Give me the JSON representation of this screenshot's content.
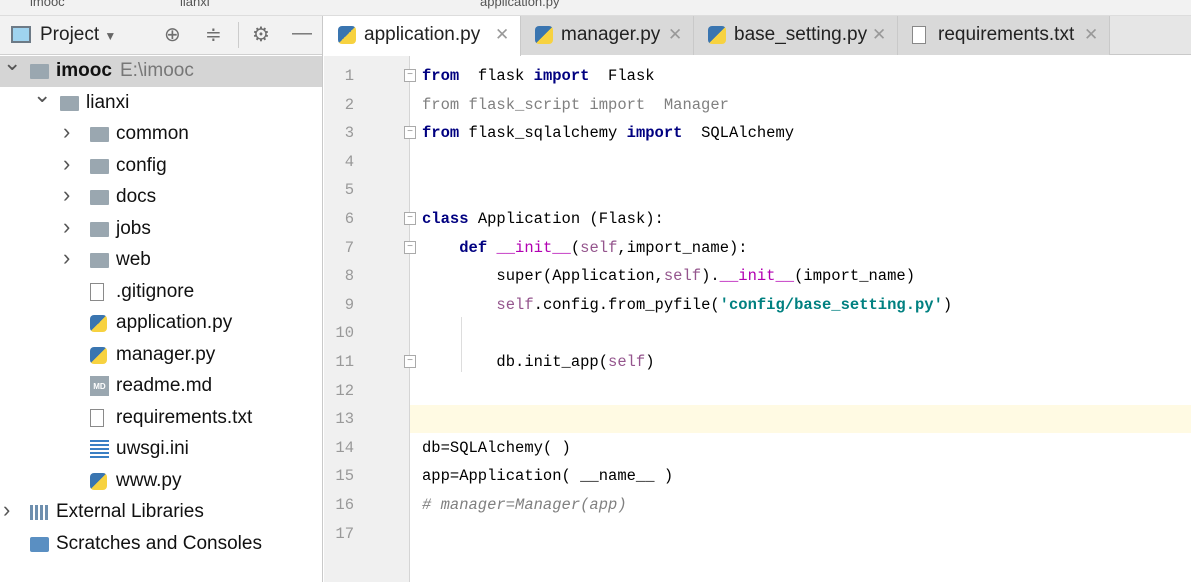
{
  "breadcrumb": [
    "imooc",
    "lianxi",
    "application.py"
  ],
  "sidebar": {
    "title": "Project",
    "tools": [
      "locate-icon",
      "collapse-icon",
      "gear-icon",
      "minimize-icon"
    ],
    "tree": [
      {
        "label": "imooc",
        "path": "E:\\imooc",
        "depth": 0,
        "type": "folder",
        "arrow": "down",
        "selected": true
      },
      {
        "label": "lianxi",
        "depth": 1,
        "type": "folder",
        "arrow": "down"
      },
      {
        "label": "common",
        "depth": 2,
        "type": "folder",
        "arrow": "right"
      },
      {
        "label": "config",
        "depth": 2,
        "type": "folder",
        "arrow": "right"
      },
      {
        "label": "docs",
        "depth": 2,
        "type": "folder",
        "arrow": "right"
      },
      {
        "label": "jobs",
        "depth": 2,
        "type": "folder",
        "arrow": "right"
      },
      {
        "label": "web",
        "depth": 2,
        "type": "folder",
        "arrow": "right"
      },
      {
        "label": ".gitignore",
        "depth": 2,
        "type": "file"
      },
      {
        "label": "application.py",
        "depth": 2,
        "type": "py"
      },
      {
        "label": "manager.py",
        "depth": 2,
        "type": "py"
      },
      {
        "label": "readme.md",
        "depth": 2,
        "type": "md"
      },
      {
        "label": "requirements.txt",
        "depth": 2,
        "type": "file"
      },
      {
        "label": "uwsgi.ini",
        "depth": 2,
        "type": "ini"
      },
      {
        "label": "www.py",
        "depth": 2,
        "type": "py"
      },
      {
        "label": "External Libraries",
        "depth": 0,
        "type": "lib",
        "arrow": "right"
      },
      {
        "label": "Scratches and Consoles",
        "depth": 0,
        "type": "scr"
      }
    ]
  },
  "tabs": [
    {
      "label": "application.py",
      "type": "py",
      "active": true
    },
    {
      "label": "manager.py",
      "type": "py"
    },
    {
      "label": "base_setting.py",
      "type": "py"
    },
    {
      "label": "requirements.txt",
      "type": "txt"
    }
  ],
  "editor": {
    "current_line": 13,
    "lines": [
      [
        [
          "from",
          "kw"
        ],
        [
          "  flask ",
          ""
        ],
        [
          "import",
          "kw"
        ],
        [
          "  Flask",
          ""
        ]
      ],
      [
        [
          "from flask_script import  Manager",
          "un"
        ]
      ],
      [
        [
          "from",
          "kw"
        ],
        [
          " flask_sqlalchemy ",
          ""
        ],
        [
          "import",
          "kw"
        ],
        [
          "  SQLAlchemy",
          ""
        ]
      ],
      [],
      [],
      [
        [
          "class",
          "kw"
        ],
        [
          " Application (Flask):",
          ""
        ]
      ],
      [
        [
          "    ",
          ""
        ],
        [
          "def",
          "kw"
        ],
        [
          " ",
          ""
        ],
        [
          "__init__",
          "mg"
        ],
        [
          "(",
          ""
        ],
        [
          "self",
          "sf"
        ],
        [
          ",import_name):",
          ""
        ]
      ],
      [
        [
          "        super(Application,",
          ""
        ],
        [
          "self",
          "sf"
        ],
        [
          ").",
          ""
        ],
        [
          "__init__",
          "mg"
        ],
        [
          "(import_name)",
          ""
        ]
      ],
      [
        [
          "        ",
          ""
        ],
        [
          "self",
          "sf"
        ],
        [
          ".config.from_pyfile(",
          ""
        ],
        [
          "'config/base_setting.py'",
          "st"
        ],
        [
          ")",
          ""
        ]
      ],
      [],
      [
        [
          "        db.init_app(",
          ""
        ],
        [
          "self",
          "sf"
        ],
        [
          ")",
          ""
        ]
      ],
      [],
      [],
      [
        [
          "db=SQLAlchemy( )",
          ""
        ]
      ],
      [
        [
          "app=Application( __name__ )",
          ""
        ]
      ],
      [
        [
          "# manager=Manager(app)",
          "cm"
        ]
      ],
      []
    ],
    "fold_lines": [
      1,
      3,
      6,
      7,
      11
    ]
  }
}
